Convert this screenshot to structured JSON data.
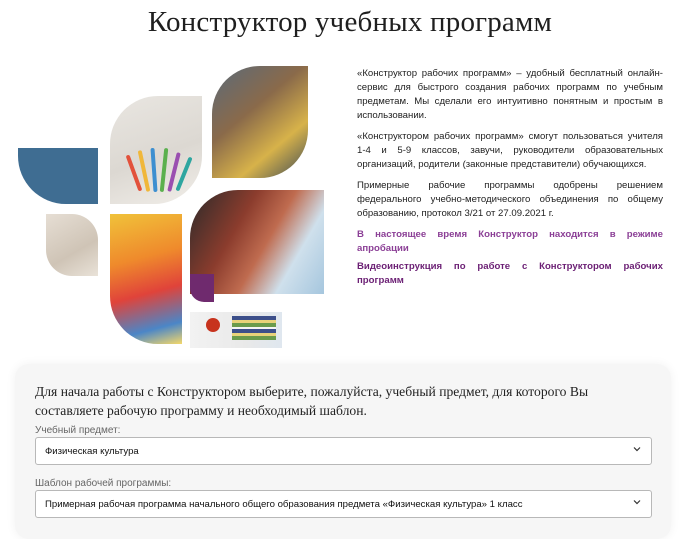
{
  "header": {
    "title": "Конструктор учебных программ"
  },
  "intro": {
    "paragraphs": [
      "«Конструктор рабочих программ» – удобный бесплатный онлайн-сервис для быстрого создания рабочих программ по учебным предметам. Мы сделали его интуитивно понятным и простым в использовании.",
      "«Конструктором рабочих программ» смогут пользоваться учителя 1-4 и 5-9 классов, завучи, руководители образовательных организаций, родители (законные представители) обучающихся.",
      "Примерные рабочие программы одобрены решением федерального учебно-методического объединения по общему образованию, протокол 3/21 от 27.09.2021 г."
    ],
    "notice": "В настоящее время Конструктор находится в режиме апробации",
    "video_link": "Видеоинструкция по работе с Конструктором рабочих программ"
  },
  "form": {
    "instruction": "Для начала работы с Конструктором выберите, пожалуйста, учебный предмет, для которого Вы составляете рабочую программу и необходимый шаблон.",
    "subject": {
      "label": "Учебный предмет:",
      "value": "Физическая культура"
    },
    "template": {
      "label": "Шаблон рабочей программы:",
      "value": "Примерная рабочая программа начального общего образования предмета «Физическая культура» 1 класс"
    }
  },
  "colors": {
    "notice": "#8b3f96",
    "link": "#6b1f74",
    "tile_blue": "#3f6d92",
    "tile_purple": "#6f2a6e"
  },
  "icons": {
    "select_arrow": "chevron-down-icon"
  }
}
